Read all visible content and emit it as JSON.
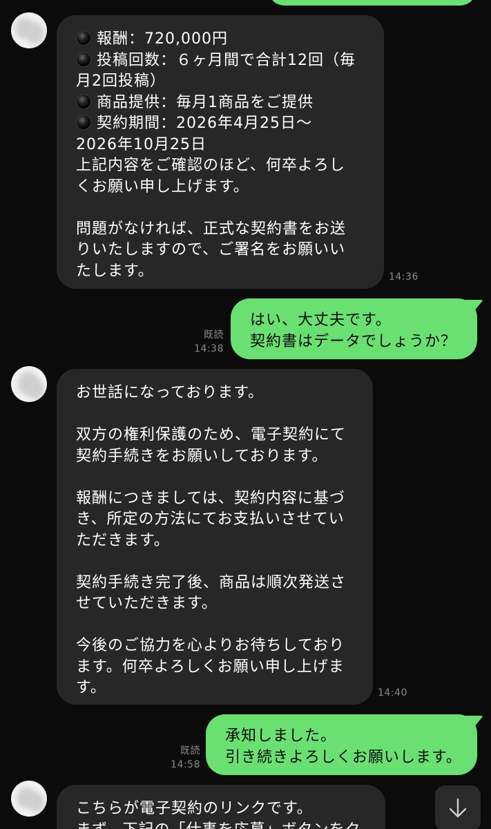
{
  "messages": [
    {
      "side": "in",
      "lines": [
        {
          "bullet": true,
          "text": "報酬：720,000円"
        },
        {
          "bullet": true,
          "text": "投稿回数：６ヶ月間で合計12回（毎"
        },
        {
          "text": "月2回投稿）"
        },
        {
          "bullet": true,
          "text": "商品提供：毎月1商品をご提供"
        },
        {
          "bullet": true,
          "text": "契約期間：2026年4月25日〜"
        },
        {
          "text": "2026年10月25日"
        },
        {
          "text": "上記内容をご確認のほど、何卒よろし"
        },
        {
          "text": "くお願い申し上げます。"
        },
        {
          "text": ""
        },
        {
          "text": "問題がなければ、正式な契約書をお送"
        },
        {
          "text": "りいたしますので、ご署名をお願いい"
        },
        {
          "text": "たします。"
        }
      ],
      "time": "14:36"
    },
    {
      "side": "out",
      "lines": [
        {
          "text": "はい、大丈夫です。"
        },
        {
          "text": "契約書はデータでしょうか？"
        }
      ],
      "read": "既読",
      "time": "14:38"
    },
    {
      "side": "in",
      "lines": [
        {
          "text": "お世話になっております。"
        },
        {
          "text": ""
        },
        {
          "text": "双方の権利保護のため、電子契約にて"
        },
        {
          "text": "契約手続きをお願いしております。"
        },
        {
          "text": ""
        },
        {
          "text": "報酬につきましては、契約内容に基づ"
        },
        {
          "text": "き、所定の方法にてお支払いさせてい"
        },
        {
          "text": "ただきます。"
        },
        {
          "text": ""
        },
        {
          "text": "契約手続き完了後、商品は順次発送さ"
        },
        {
          "text": "せていただきます。"
        },
        {
          "text": ""
        },
        {
          "text": "今後のご協力を心よりお待ちしており"
        },
        {
          "text": "ます。何卒よろしくお願い申し上げま"
        },
        {
          "text": "す。"
        }
      ],
      "time": "14:40"
    },
    {
      "side": "out",
      "lines": [
        {
          "text": "承知しました。"
        },
        {
          "text": "引き続きよろしくお願いします。"
        }
      ],
      "read": "既読",
      "time": "14:58"
    },
    {
      "side": "in",
      "lines": [
        {
          "text": "こちらが電子契約のリンクです。"
        },
        {
          "text": "まず、下記の「仕事を応募」ボタンをク"
        }
      ]
    }
  ],
  "colors": {
    "background": "#0b0b0b",
    "incoming_bubble": "#272727",
    "outgoing_bubble": "#6ae073",
    "meta_text": "#8a8a8a"
  },
  "icons": {
    "scroll_down": "arrow-down-icon",
    "bullet": "black-circle-icon"
  }
}
